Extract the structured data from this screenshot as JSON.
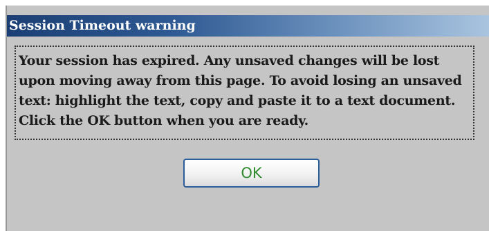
{
  "dialog": {
    "title": "Session Timeout warning",
    "message": "Your session has expired. Any unsaved changes will be lost upon moving away from this page. To avoid losing an unsaved text: highlight the text, copy and paste it to a text document. Click the OK button when you are ready.",
    "ok_label": "OK"
  },
  "colors": {
    "title_bar_start": "#1b3f74",
    "title_bar_end": "#a9c4df",
    "dialog_background": "#c5c5c5",
    "ok_text": "#2e8b2e",
    "ok_border": "#2a5d9a"
  }
}
